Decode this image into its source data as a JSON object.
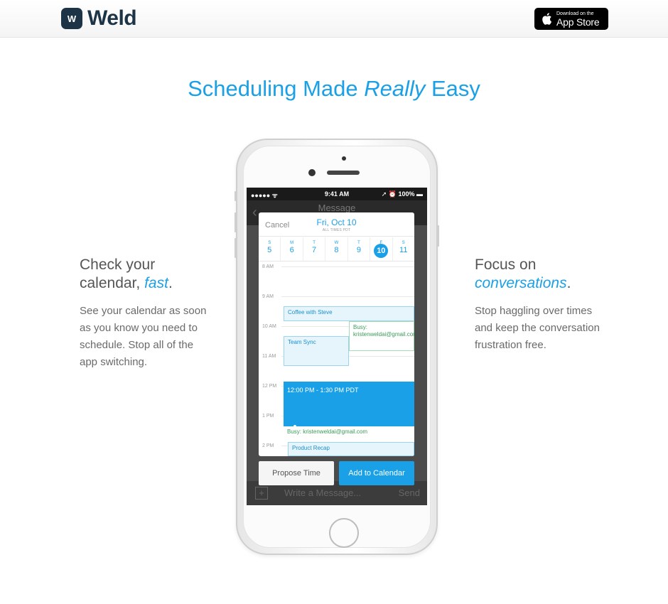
{
  "header": {
    "logo_mark": "W",
    "logo_text": "Weld",
    "appstore_small": "Download on the",
    "appstore_big": "App Store"
  },
  "hero": {
    "title_before": "Scheduling Made ",
    "title_em": "Really",
    "title_after": " Easy"
  },
  "left_feature": {
    "heading_line1": "Check your",
    "heading_line2_before": "calendar, ",
    "heading_accent": "fast",
    "heading_after": ".",
    "body": "See your calendar as soon as you know you need to schedule. Stop all of the app switching."
  },
  "right_feature": {
    "heading_line1": "Focus on",
    "heading_accent": "conversations",
    "heading_after": ".",
    "body": "Stop haggling over times and keep the conversation frustration free."
  },
  "phone": {
    "status": {
      "signal": "●●●●● ᯤ",
      "time": "9:41 AM",
      "right": "➚ ⏰ 100% ▬"
    },
    "nav_title": "Message",
    "message_placeholder": "Write a Message...",
    "send_label": "Send",
    "calendar": {
      "cancel": "Cancel",
      "date_title": "Fri, Oct 10",
      "date_sub": "ALL TIMES PDT",
      "days": [
        {
          "letter": "S",
          "num": "5"
        },
        {
          "letter": "M",
          "num": "6"
        },
        {
          "letter": "T",
          "num": "7"
        },
        {
          "letter": "W",
          "num": "8"
        },
        {
          "letter": "T",
          "num": "9"
        },
        {
          "letter": "F",
          "num": "10"
        },
        {
          "letter": "S",
          "num": "11"
        }
      ],
      "selected_day": "10",
      "hours": [
        "8 AM",
        "9 AM",
        "10 AM",
        "11 AM",
        "12 PM",
        "1 PM",
        "2 PM"
      ],
      "events": {
        "coffee": "Coffee with Steve",
        "busy1": "Busy: kristenweldai@gmail.com",
        "team_sync": "Team Sync",
        "selected": "12:00 PM - 1:30 PM PDT",
        "busy2": "Busy: kristenweldai@gmail.com",
        "product_recap": "Product Recap"
      }
    },
    "propose_button": "Propose Time",
    "add_button": "Add to Calendar"
  },
  "colors": {
    "accent": "#1aa0e6",
    "brand_dark": "#1d3447"
  }
}
